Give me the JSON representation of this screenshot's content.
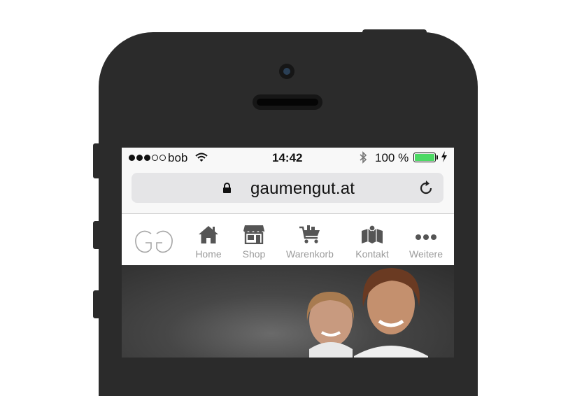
{
  "status_bar": {
    "carrier": "bob",
    "time": "14:42",
    "battery_percent": "100 %",
    "battery_level": 1.0,
    "signal_bars_filled": 3,
    "signal_bars_total": 5
  },
  "address_bar": {
    "url": "gaumengut.at",
    "icons": [
      "lock-icon",
      "reload-icon"
    ]
  },
  "site_nav": {
    "logo_text": "GG",
    "items": [
      {
        "label": "Home",
        "icon": "home-icon"
      },
      {
        "label": "Shop",
        "icon": "shop-icon"
      },
      {
        "label": "Warenkorb",
        "icon": "cart-icon"
      },
      {
        "label": "Kontakt",
        "icon": "map-icon"
      },
      {
        "label": "Weitere",
        "icon": "more-icon"
      }
    ]
  },
  "colors": {
    "phone_frame": "#2b2b2b",
    "battery_fill": "#4cd964",
    "nav_icon": "#555555",
    "nav_label": "#9b9b9b"
  }
}
